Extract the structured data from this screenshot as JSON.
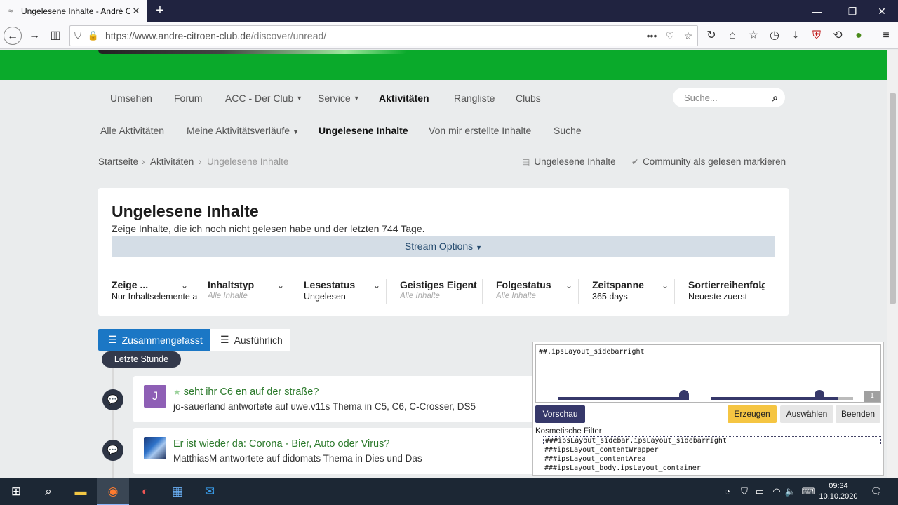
{
  "browser": {
    "tab_title": "Ungelesene Inhalte - André Citroën Club",
    "url": "https://www.andre-citroen-club.de/discover/unread/",
    "url_host": "https://www.andre-citroen-club.de",
    "url_path": "/discover/unread/",
    "new_tab": "+",
    "close_tab": "✕"
  },
  "mainnav": {
    "items": [
      {
        "label": "Umsehen"
      },
      {
        "label": "Forum"
      },
      {
        "label": "ACC - Der Club"
      },
      {
        "label": "Service"
      },
      {
        "label": "Aktivitäten"
      },
      {
        "label": "Rangliste"
      },
      {
        "label": "Clubs"
      }
    ],
    "search_placeholder": "Suche..."
  },
  "subnav": {
    "items": [
      {
        "label": "Alle Aktivitäten"
      },
      {
        "label": "Meine Aktivitätsverläufe"
      },
      {
        "label": "Ungelesene Inhalte"
      },
      {
        "label": "Von mir erstellte Inhalte"
      },
      {
        "label": "Suche"
      }
    ]
  },
  "breadcrumb": {
    "items": [
      "Startseite",
      "Aktivitäten",
      "Ungelesene Inhalte"
    ],
    "sep": "›",
    "actions": [
      "Ungelesene Inhalte",
      "Community als gelesen markieren"
    ]
  },
  "header": {
    "title": "Ungelesene Inhalte",
    "description": "Zeige Inhalte, die ich noch nicht gelesen habe und der letzten 744 Tage.",
    "stream_options": "Stream Options"
  },
  "filters": [
    {
      "label": "Zeige ...",
      "value": "Nur Inhaltselemente anzeigen",
      "dim": false
    },
    {
      "label": "Inhaltstyp",
      "value": "Alle Inhalte",
      "dim": true
    },
    {
      "label": "Lesestatus",
      "value": "Ungelesen",
      "dim": false
    },
    {
      "label": "Geistiges Eigentum",
      "value": "Alle Inhalte",
      "dim": true
    },
    {
      "label": "Folgestatus",
      "value": "Alle Inhalte",
      "dim": true
    },
    {
      "label": "Zeitspanne",
      "value": "365 days",
      "dim": false
    },
    {
      "label": "Sortierreihenfolge",
      "value": "Neueste zuerst",
      "dim": false
    }
  ],
  "view": {
    "condensed": "Zusammengefasst",
    "expanded": "Ausführlich"
  },
  "timeline_badge": "Letzte Stunde",
  "stream": [
    {
      "avatar_letter": "J",
      "title": "seht ihr C6 en auf der straße?",
      "subtitle": "jo-sauerland antwortete auf uwe.v11s Thema in C5, C6, C-Crosser, DS5"
    },
    {
      "avatar_letter": "",
      "title": "Er ist wieder da: Corona - Bier, Auto oder Virus?",
      "subtitle": "MatthiasM antwortete auf didomats Thema in Dies und Das"
    }
  ],
  "picker": {
    "filter_text": "##.ipsLayout_sidebarright",
    "count": "1",
    "preview": "Vorschau",
    "create": "Erzeugen",
    "select": "Auswählen",
    "quit": "Beenden",
    "cosmetic_label": "Kosmetische Filter",
    "rules": [
      "###ipsLayout_sidebar.ipsLayout_sidebarright",
      "###ipsLayout_contentWrapper",
      "###ipsLayout_contentArea",
      "###ipsLayout_body.ipsLayout_container"
    ]
  },
  "taskbar": {
    "time": "09:34",
    "date": "10.10.2020"
  },
  "colors": {
    "accent_green": "#0aaa2b",
    "primary_blue": "#1b77c5",
    "link_green": "#2c7a2c",
    "picker_dark": "#36386a",
    "picker_yellow": "#f5c542"
  }
}
